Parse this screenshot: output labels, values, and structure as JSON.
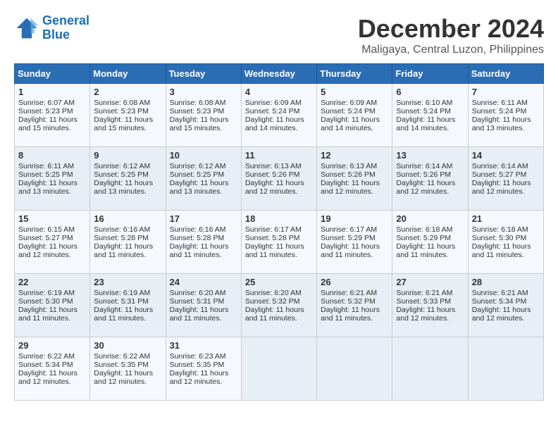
{
  "header": {
    "logo_line1": "General",
    "logo_line2": "Blue",
    "main_title": "December 2024",
    "subtitle": "Maligaya, Central Luzon, Philippines"
  },
  "days_of_week": [
    "Sunday",
    "Monday",
    "Tuesday",
    "Wednesday",
    "Thursday",
    "Friday",
    "Saturday"
  ],
  "weeks": [
    [
      {
        "day": "1",
        "sunrise": "Sunrise: 6:07 AM",
        "sunset": "Sunset: 5:23 PM",
        "daylight": "Daylight: 11 hours and 15 minutes."
      },
      {
        "day": "2",
        "sunrise": "Sunrise: 6:08 AM",
        "sunset": "Sunset: 5:23 PM",
        "daylight": "Daylight: 11 hours and 15 minutes."
      },
      {
        "day": "3",
        "sunrise": "Sunrise: 6:08 AM",
        "sunset": "Sunset: 5:23 PM",
        "daylight": "Daylight: 11 hours and 15 minutes."
      },
      {
        "day": "4",
        "sunrise": "Sunrise: 6:09 AM",
        "sunset": "Sunset: 5:24 PM",
        "daylight": "Daylight: 11 hours and 14 minutes."
      },
      {
        "day": "5",
        "sunrise": "Sunrise: 6:09 AM",
        "sunset": "Sunset: 5:24 PM",
        "daylight": "Daylight: 11 hours and 14 minutes."
      },
      {
        "day": "6",
        "sunrise": "Sunrise: 6:10 AM",
        "sunset": "Sunset: 5:24 PM",
        "daylight": "Daylight: 11 hours and 14 minutes."
      },
      {
        "day": "7",
        "sunrise": "Sunrise: 6:11 AM",
        "sunset": "Sunset: 5:24 PM",
        "daylight": "Daylight: 11 hours and 13 minutes."
      }
    ],
    [
      {
        "day": "8",
        "sunrise": "Sunrise: 6:11 AM",
        "sunset": "Sunset: 5:25 PM",
        "daylight": "Daylight: 11 hours and 13 minutes."
      },
      {
        "day": "9",
        "sunrise": "Sunrise: 6:12 AM",
        "sunset": "Sunset: 5:25 PM",
        "daylight": "Daylight: 11 hours and 13 minutes."
      },
      {
        "day": "10",
        "sunrise": "Sunrise: 6:12 AM",
        "sunset": "Sunset: 5:25 PM",
        "daylight": "Daylight: 11 hours and 13 minutes."
      },
      {
        "day": "11",
        "sunrise": "Sunrise: 6:13 AM",
        "sunset": "Sunset: 5:26 PM",
        "daylight": "Daylight: 11 hours and 12 minutes."
      },
      {
        "day": "12",
        "sunrise": "Sunrise: 6:13 AM",
        "sunset": "Sunset: 5:26 PM",
        "daylight": "Daylight: 11 hours and 12 minutes."
      },
      {
        "day": "13",
        "sunrise": "Sunrise: 6:14 AM",
        "sunset": "Sunset: 5:26 PM",
        "daylight": "Daylight: 11 hours and 12 minutes."
      },
      {
        "day": "14",
        "sunrise": "Sunrise: 6:14 AM",
        "sunset": "Sunset: 5:27 PM",
        "daylight": "Daylight: 11 hours and 12 minutes."
      }
    ],
    [
      {
        "day": "15",
        "sunrise": "Sunrise: 6:15 AM",
        "sunset": "Sunset: 5:27 PM",
        "daylight": "Daylight: 11 hours and 12 minutes."
      },
      {
        "day": "16",
        "sunrise": "Sunrise: 6:16 AM",
        "sunset": "Sunset: 5:28 PM",
        "daylight": "Daylight: 11 hours and 11 minutes."
      },
      {
        "day": "17",
        "sunrise": "Sunrise: 6:16 AM",
        "sunset": "Sunset: 5:28 PM",
        "daylight": "Daylight: 11 hours and 11 minutes."
      },
      {
        "day": "18",
        "sunrise": "Sunrise: 6:17 AM",
        "sunset": "Sunset: 5:28 PM",
        "daylight": "Daylight: 11 hours and 11 minutes."
      },
      {
        "day": "19",
        "sunrise": "Sunrise: 6:17 AM",
        "sunset": "Sunset: 5:29 PM",
        "daylight": "Daylight: 11 hours and 11 minutes."
      },
      {
        "day": "20",
        "sunrise": "Sunrise: 6:18 AM",
        "sunset": "Sunset: 5:29 PM",
        "daylight": "Daylight: 11 hours and 11 minutes."
      },
      {
        "day": "21",
        "sunrise": "Sunrise: 6:18 AM",
        "sunset": "Sunset: 5:30 PM",
        "daylight": "Daylight: 11 hours and 11 minutes."
      }
    ],
    [
      {
        "day": "22",
        "sunrise": "Sunrise: 6:19 AM",
        "sunset": "Sunset: 5:30 PM",
        "daylight": "Daylight: 11 hours and 11 minutes."
      },
      {
        "day": "23",
        "sunrise": "Sunrise: 6:19 AM",
        "sunset": "Sunset: 5:31 PM",
        "daylight": "Daylight: 11 hours and 11 minutes."
      },
      {
        "day": "24",
        "sunrise": "Sunrise: 6:20 AM",
        "sunset": "Sunset: 5:31 PM",
        "daylight": "Daylight: 11 hours and 11 minutes."
      },
      {
        "day": "25",
        "sunrise": "Sunrise: 6:20 AM",
        "sunset": "Sunset: 5:32 PM",
        "daylight": "Daylight: 11 hours and 11 minutes."
      },
      {
        "day": "26",
        "sunrise": "Sunrise: 6:21 AM",
        "sunset": "Sunset: 5:32 PM",
        "daylight": "Daylight: 11 hours and 11 minutes."
      },
      {
        "day": "27",
        "sunrise": "Sunrise: 6:21 AM",
        "sunset": "Sunset: 5:33 PM",
        "daylight": "Daylight: 11 hours and 12 minutes."
      },
      {
        "day": "28",
        "sunrise": "Sunrise: 6:21 AM",
        "sunset": "Sunset: 5:34 PM",
        "daylight": "Daylight: 11 hours and 12 minutes."
      }
    ],
    [
      {
        "day": "29",
        "sunrise": "Sunrise: 6:22 AM",
        "sunset": "Sunset: 5:34 PM",
        "daylight": "Daylight: 11 hours and 12 minutes."
      },
      {
        "day": "30",
        "sunrise": "Sunrise: 6:22 AM",
        "sunset": "Sunset: 5:35 PM",
        "daylight": "Daylight: 11 hours and 12 minutes."
      },
      {
        "day": "31",
        "sunrise": "Sunrise: 6:23 AM",
        "sunset": "Sunset: 5:35 PM",
        "daylight": "Daylight: 11 hours and 12 minutes."
      },
      null,
      null,
      null,
      null
    ]
  ]
}
